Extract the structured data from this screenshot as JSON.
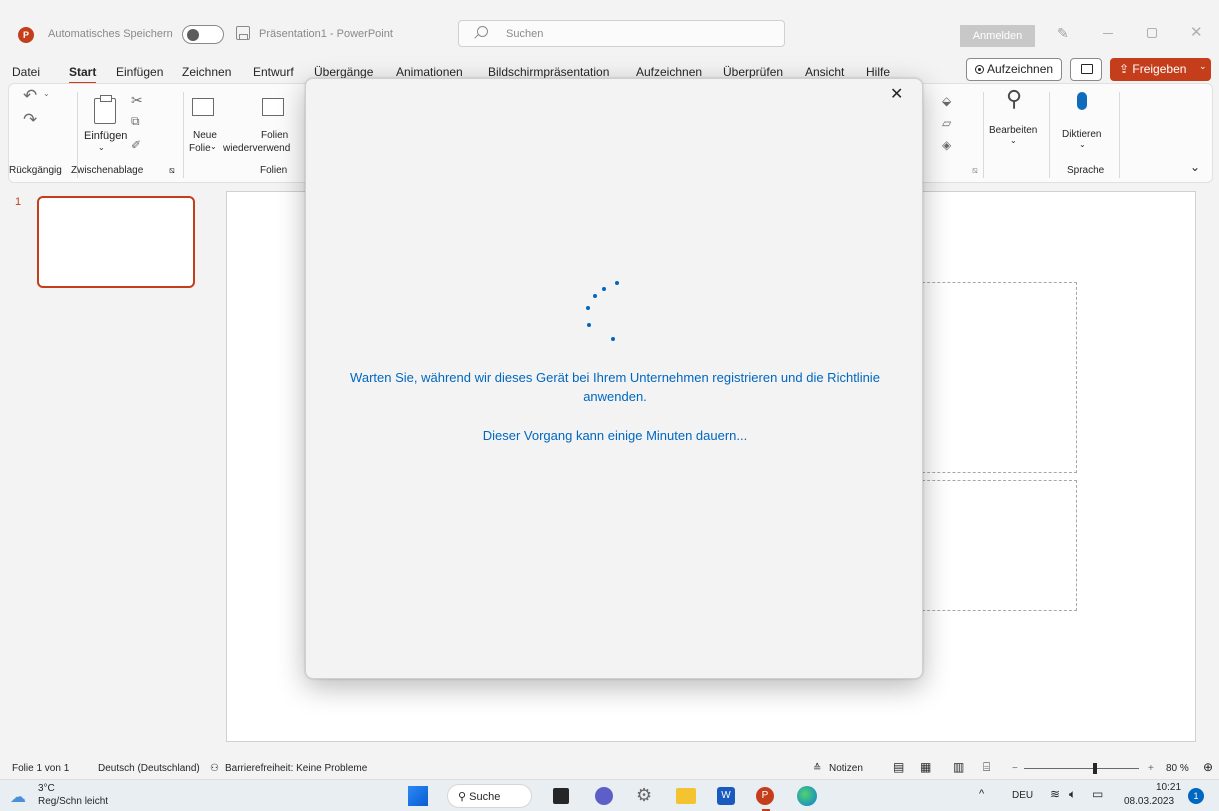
{
  "titlebar": {
    "autosave_label": "Automatisches Speichern",
    "doc_title": "Präsentation1  -  PowerPoint",
    "search_placeholder": "Suchen",
    "signin_label": "Anmelden",
    "logo_letter": "P"
  },
  "tabs": [
    "Datei",
    "Start",
    "Einfügen",
    "Zeichnen",
    "Entwurf",
    "Übergänge",
    "Animationen",
    "Bildschirmpräsentation",
    "Aufzeichnen",
    "Überprüfen",
    "Ansicht",
    "Hilfe"
  ],
  "active_tab": "Start",
  "actions": {
    "record_label": "Aufzeichnen",
    "share_label": "Freigeben"
  },
  "ribbon": {
    "undo_group": "Rückgängig",
    "clipboard_group": "Zwischenablage",
    "paste_label": "Einfügen",
    "slides_group": "Folien",
    "new_slide_line1": "Neue",
    "new_slide_line2": "Folie",
    "reuse_line1": "Folien",
    "reuse_line2": "wiederverwend",
    "edit_label": "Bearbeiten",
    "dictate_label": "Diktieren",
    "voice_group": "Sprache"
  },
  "slides": {
    "thumb_number": "1"
  },
  "dialog": {
    "message": "Warten Sie, während wir dieses Gerät bei Ihrem Unternehmen registrieren und die Richtlinie anwenden.",
    "submessage": "Dieser Vorgang kann einige Minuten dauern..."
  },
  "statusbar": {
    "slide_info": "Folie 1 von 1",
    "language": "Deutsch (Deutschland)",
    "accessibility": "Barrierefreiheit: Keine Probleme",
    "notes_label": "Notizen",
    "zoom": "80 %",
    "zoom_minus": "−",
    "zoom_plus": "+"
  },
  "taskbar": {
    "weather_temp": "3°C",
    "weather_desc": "Reg/Schn leicht",
    "search_label": "Suche",
    "lang": "DEU",
    "time": "10:21",
    "date": "08.03.2023",
    "notification_count": "1"
  },
  "colors": {
    "accent": "#c43e1c",
    "dialog_text": "#0067c0"
  }
}
